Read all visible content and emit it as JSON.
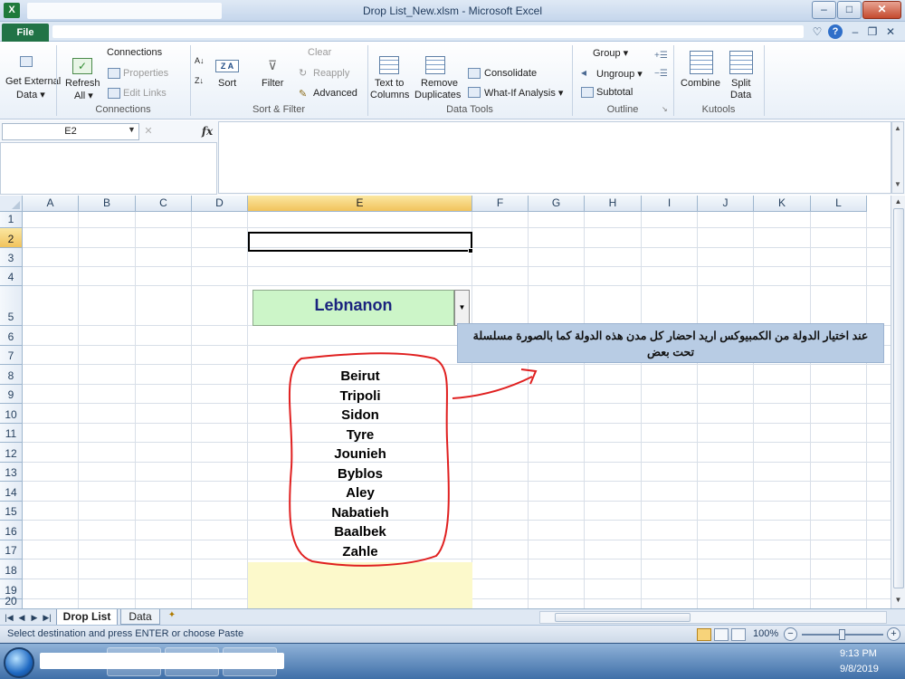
{
  "window": {
    "title": "Drop List_New.xlsm  -  Microsoft Excel",
    "app_icon_glyph": "X",
    "min_glyph": "–",
    "max_glyph": "□",
    "close_glyph": "✕"
  },
  "tabs": {
    "file": "File",
    "top_right_glyphs": {
      "ribbon_toggle": "♡",
      "help": "?",
      "doc_min": "–",
      "doc_restore": "❐",
      "doc_close": "✕"
    }
  },
  "ribbon": {
    "get_external_data": {
      "line1": "Get External",
      "line2": "Data ▾"
    },
    "connections": {
      "refresh_label": "Refresh",
      "refresh_all": "All ▾",
      "connections_label": "Connections",
      "properties": "Properties",
      "edit_links": "Edit Links",
      "group_label": "Connections"
    },
    "sort_filter": {
      "sort_label": "Sort",
      "filter_label": "Filter",
      "clear_label": "Clear",
      "reapply_label": "Reapply",
      "advanced_label": "Advanced",
      "za_label": "Z A",
      "group_label": "Sort & Filter"
    },
    "data_tools": {
      "text_to_columns_1": "Text to",
      "text_to_columns_2": "Columns",
      "remove_duplicates_1": "Remove",
      "remove_duplicates_2": "Duplicates",
      "consolidate": "Consolidate",
      "what_if": "What-If Analysis ▾",
      "group_label": "Data Tools"
    },
    "outline": {
      "group_label": "Group ▾",
      "ungroup_label": "Ungroup ▾",
      "subtotal_label": "Subtotal",
      "group_name": "Outline",
      "launcher_glyph": "↘"
    },
    "kutools": {
      "combine_label": "Combine",
      "split_1": "Split",
      "split_2": "Data",
      "group_label": "Kutools"
    }
  },
  "formula_bar": {
    "name_box": "E2",
    "name_box_arrow": "▼",
    "cancel_glyph": "✕",
    "fx_label": "fx",
    "formula": "",
    "scroll_up": "▲",
    "scroll_down": "▼"
  },
  "sheet": {
    "columns": [
      "A",
      "B",
      "C",
      "D",
      "E",
      "F",
      "G",
      "H",
      "I",
      "J",
      "K",
      "L"
    ],
    "selected_column": "E",
    "rows": [
      "1",
      "2",
      "3",
      "4",
      "5",
      "6",
      "7",
      "8",
      "9",
      "10",
      "11",
      "12",
      "13",
      "14",
      "15",
      "16",
      "17",
      "18",
      "19",
      "20"
    ],
    "selected_row": "2",
    "combo_value": "Lebnanon",
    "combo_arrow_glyph": "▼",
    "cities": [
      "Beirut",
      "Tripoli",
      "Sidon",
      "Tyre",
      "Jounieh",
      "Byblos",
      "Aley",
      "Nabatieh",
      "Baalbek",
      "Zahle"
    ],
    "note": "عند اختيار الدولة من الكمبيوكس اريد احضار كل مدن هذه الدولة كما بالصورة مسلسلة تحت بعض"
  },
  "sheet_tabs": {
    "nav_glyphs": [
      "|◀",
      "◀",
      "▶",
      "▶|"
    ],
    "tabs": [
      "Drop List",
      "Data"
    ],
    "active_tab": "Drop List",
    "new_sheet_glyph": "✦"
  },
  "status": {
    "text": "Select destination and press ENTER or choose Paste",
    "zoom": "100%",
    "zoom_out_glyph": "−",
    "zoom_in_glyph": "+"
  },
  "taskbar": {
    "time": "9:13 PM",
    "date": "9/8/2019"
  }
}
